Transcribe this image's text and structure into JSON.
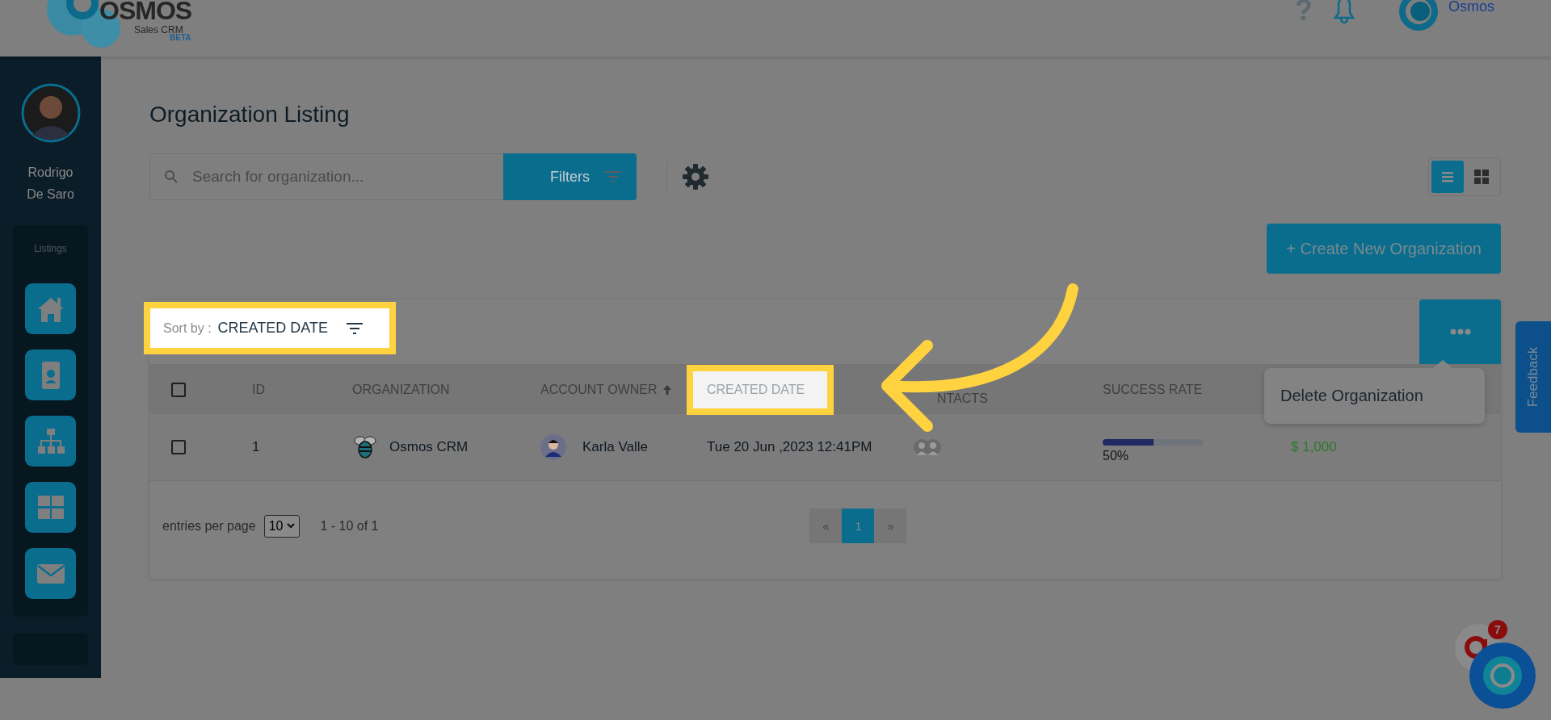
{
  "header": {
    "logo": {
      "name": "OSMOS",
      "product": "Sales CRM",
      "tag": "BETA"
    },
    "help": "?",
    "user": "Osmos"
  },
  "sidebar": {
    "user_name": "Rodrigo De Saro",
    "section": "Listings",
    "items": [
      {
        "kind": "home"
      },
      {
        "kind": "contact"
      },
      {
        "kind": "hierarchy"
      },
      {
        "kind": "grid"
      },
      {
        "kind": "mail"
      }
    ]
  },
  "page": {
    "title": "Organization Listing",
    "search": {
      "placeholder": "Search for organization..."
    },
    "filters_button": "Filters",
    "view_toggle": [
      {
        "kind": "list",
        "selected": true
      },
      {
        "kind": "grid",
        "selected": false
      }
    ],
    "create_button": "+ Create New Organization",
    "sort": {
      "label": "Sort by :",
      "value": "CREATED DATE",
      "highlighted": true
    },
    "menu": [
      "Delete Organization"
    ],
    "table": {
      "select_all": {
        "checked": false
      },
      "columns": [
        {
          "label": "ID",
          "sorted": false,
          "highlighted": false
        },
        {
          "label": "ORGANIZATION",
          "sorted": false,
          "highlighted": false
        },
        {
          "label": "ACCOUNT OWNER",
          "sorted": true,
          "highlighted": false
        },
        {
          "label": "CREATED DATE",
          "sorted": false,
          "highlighted": true
        },
        {
          "label": "NTACTS",
          "sorted": false,
          "highlighted": false
        },
        {
          "label": "SUCCESS RATE",
          "sorted": false,
          "highlighted": false
        }
      ],
      "rows": [
        {
          "selected": false,
          "id": "1",
          "organization": "Osmos CRM",
          "owner": "Karla Valle",
          "created": "Tue 20 Jun ,2023 12:41PM",
          "level": 0.5,
          "rate": "50%",
          "value": "$ 1,000"
        }
      ]
    },
    "footer": {
      "entries_label": "entries per page",
      "entries_value": "10",
      "range": "1 - 10 of 1",
      "pages": [
        {
          "label": "«",
          "selected": false
        },
        {
          "label": "1",
          "selected": true
        },
        {
          "label": "»",
          "selected": false
        }
      ]
    }
  },
  "feedback": "Feedback",
  "chat_badge": "7"
}
